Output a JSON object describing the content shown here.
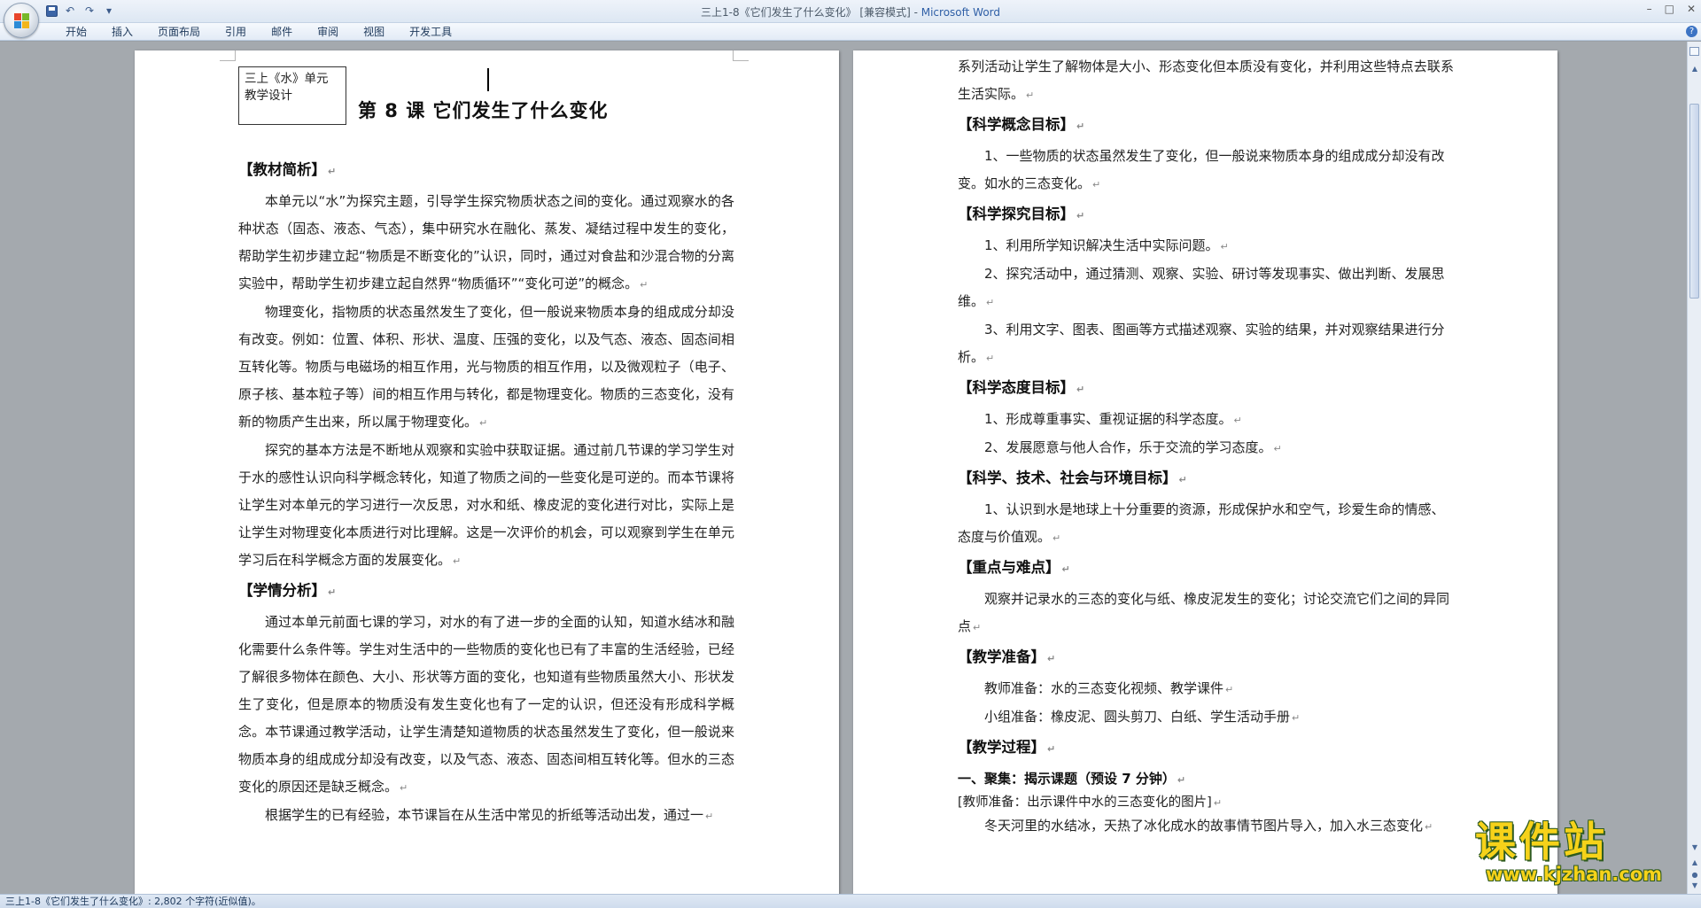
{
  "window": {
    "title": "三上1-8《它们发生了什么变化》 [兼容模式] - ",
    "app_name": "Microsoft Word",
    "controls": [
      "–",
      "□",
      "✕"
    ]
  },
  "qat": {
    "save_icon": "save-icon",
    "undo_glyph": "↶",
    "redo_glyph": "↷",
    "more_glyph": "▾"
  },
  "ribbon": {
    "tabs": [
      "开始",
      "插入",
      "页面布局",
      "引用",
      "邮件",
      "审阅",
      "视图",
      "开发工具"
    ],
    "help_glyph": "?"
  },
  "left_page": {
    "unit_box": [
      "三上《水》单元",
      "教学设计"
    ],
    "lesson_title": "第 8 课  它们发生了什么变化",
    "sections": [
      {
        "type": "head",
        "text": "【教材简析】"
      },
      {
        "type": "para",
        "text": "本单元以“水”为探究主题，引导学生探究物质状态之间的变化。通过观察水的各种状态（固态、液态、气态），集中研究水在融化、蒸发、凝结过程中发生的变化，帮助学生初步建立起“物质是不断变化的”认识，同时，通过对食盐和沙混合物的分离实验中，帮助学生初步建立起自然界“物质循环”“变化可逆”的概念。"
      },
      {
        "type": "para",
        "text": "物理变化，指物质的状态虽然发生了变化，但一般说来物质本身的组成成分却没有改变。例如：位置、体积、形状、温度、压强的变化，以及气态、液态、固态间相互转化等。物质与电磁场的相互作用，光与物质的相互作用，以及微观粒子（电子、原子核、基本粒子等）间的相互作用与转化，都是物理变化。物质的三态变化，没有新的物质产生出来，所以属于物理变化。"
      },
      {
        "type": "para",
        "text": "探究的基本方法是不断地从观察和实验中获取证据。通过前几节课的学习学生对于水的感性认识向科学概念转化，知道了物质之间的一些变化是可逆的。而本节课将让学生对本单元的学习进行一次反思，对水和纸、橡皮泥的变化进行对比，实际上是让学生对物理变化本质进行对比理解。这是一次评价的机会，可以观察到学生在单元学习后在科学概念方面的发展变化。"
      },
      {
        "type": "head",
        "text": "【学情分析】"
      },
      {
        "type": "para",
        "text": "通过本单元前面七课的学习，对水的有了进一步的全面的认知，知道水结冰和融化需要什么条件等。学生对生活中的一些物质的变化也已有了丰富的生活经验，已经了解很多物体在颜色、大小、形状等方面的变化，也知道有些物质虽然大小、形状发生了变化，但是原本的物质没有发生变化也有了一定的认识，但还没有形成科学概念。本节课通过教学活动，让学生清楚知道物质的状态虽然发生了变化，但一般说来物质本身的组成成分却没有改变，以及气态、液态、固态间相互转化等。但水的三态变化的原因还是缺乏概念。"
      },
      {
        "type": "para",
        "text": "根据学生的已有经验，本节课旨在从生活中常见的折纸等活动出发，通过一"
      }
    ]
  },
  "right_page": {
    "sections": [
      {
        "type": "plain",
        "text": "系列活动让学生了解物体是大小、形态变化但本质没有变化，并利用这些特点去联系生活实际。"
      },
      {
        "type": "head",
        "text": "【科学概念目标】"
      },
      {
        "type": "item",
        "text": "1、一些物质的状态虽然发生了变化，但一般说来物质本身的组成成分却没有改变。如水的三态变化。"
      },
      {
        "type": "head",
        "text": "【科学探究目标】"
      },
      {
        "type": "item",
        "text": "1、利用所学知识解决生活中实际问题。"
      },
      {
        "type": "item",
        "text": "2、探究活动中，通过猜测、观察、实验、研讨等发现事实、做出判断、发展思维。"
      },
      {
        "type": "item",
        "text": "3、利用文字、图表、图画等方式描述观察、实验的结果，并对观察结果进行分析。"
      },
      {
        "type": "head",
        "text": "【科学态度目标】"
      },
      {
        "type": "item",
        "text": "1、形成尊重事实、重视证据的科学态度。"
      },
      {
        "type": "item",
        "text": "2、发展愿意与他人合作，乐于交流的学习态度。"
      },
      {
        "type": "head",
        "text": "【科学、技术、社会与环境目标】"
      },
      {
        "type": "item",
        "text": "1、认识到水是地球上十分重要的资源，形成保护水和空气，珍爱生命的情感、态度与价值观。"
      },
      {
        "type": "head",
        "text": "【重点与难点】"
      },
      {
        "type": "item",
        "text": "观察并记录水的三态的变化与纸、橡皮泥发生的变化；讨论交流它们之间的异同点"
      },
      {
        "type": "head",
        "text": "【教学准备】"
      },
      {
        "type": "item",
        "text": "教师准备：水的三态变化视频、教学课件"
      },
      {
        "type": "item",
        "text": "小组准备：橡皮泥、圆头剪刀、白纸、学生活动手册"
      },
      {
        "type": "head",
        "text": "【教学过程】"
      },
      {
        "type": "subhead",
        "text": "一、聚集：揭示课题（预设 7 分钟）"
      },
      {
        "type": "plain-small",
        "text": "[教师准备：出示课件中水的三态变化的图片]"
      },
      {
        "type": "item",
        "text": "冬天河里的水结冰，天热了冰化成水的故事情节图片导入，加入水三态变化"
      }
    ]
  },
  "status": {
    "text": "三上1-8《它们发生了什么变化》: 2,802 个字符(近似值)。"
  },
  "watermark": {
    "main": "课件站",
    "url": "www.kjzhan.com"
  },
  "colors": {
    "app_name": "#2f5fa6",
    "watermark": "#f6d21a"
  }
}
